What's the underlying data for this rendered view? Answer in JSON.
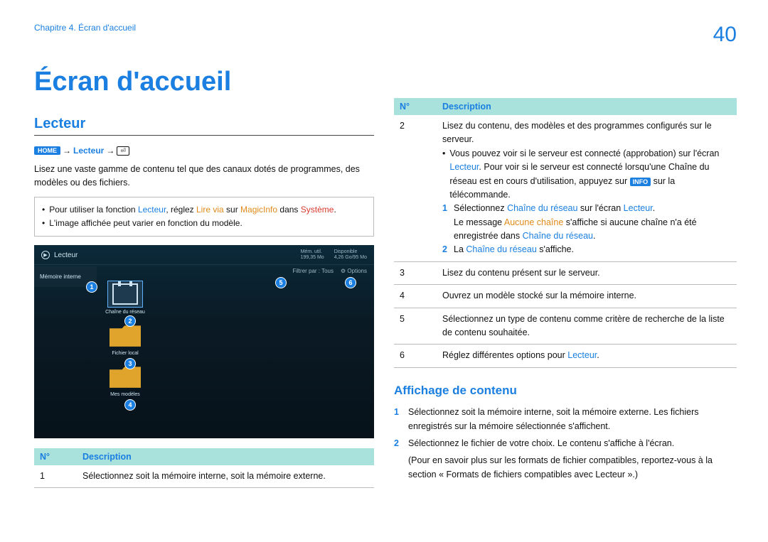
{
  "header": {
    "chapter": "Chapitre 4. Écran d'accueil",
    "page_number": "40"
  },
  "title": "Écran d'accueil",
  "section_heading": "Lecteur",
  "breadcrumb": {
    "home_label": "HOME",
    "arrow": "→",
    "crumb": "Lecteur",
    "enter_glyph": "⏎"
  },
  "intro_text": "Lisez une vaste gamme de contenu tel que des canaux dotés de programmes, des modèles ou des fichiers.",
  "note": {
    "line1_prefix": "Pour utiliser la fonction ",
    "line1_lecteur": "Lecteur",
    "line1_mid1": ", réglez ",
    "line1_lirevia": "Lire via",
    "line1_mid2": " sur ",
    "line1_magicinfo": "MagicInfo",
    "line1_mid3": " dans ",
    "line1_systeme": "Système",
    "line1_end": ".",
    "line2": "L'image affichée peut varier en fonction du modèle."
  },
  "screenshot": {
    "title": "Lecteur",
    "mem_used_label": "Mém. util.",
    "mem_used_value": "199,35 Mo",
    "disp_label": "Disponible",
    "disp_value": "4,26 Go/95 Mo",
    "filter_label": "Filtrer par : Tous",
    "options_label": "Options",
    "sidebar_item": "Mémoire interne",
    "tile1_label": "Chaîne du réseau",
    "tile2_label": "Fichier local",
    "tile3_label": "Mes modèles",
    "callouts": [
      "1",
      "2",
      "3",
      "4",
      "5",
      "6"
    ]
  },
  "table_head": {
    "num": "N°",
    "desc": "Description"
  },
  "table1_rows": [
    {
      "num": "1",
      "desc": "Sélectionnez soit la mémoire interne, soit la mémoire externe."
    }
  ],
  "table2_rows": {
    "r2": {
      "num": "2",
      "line1": "Lisez du contenu, des modèles et des programmes configurés sur le serveur.",
      "bullet_pre": "Vous pouvez voir si le serveur est connecté (approbation) sur l'écran ",
      "bullet_lecteur": "Lecteur",
      "bullet_mid": ". Pour voir si le serveur est connecté lorsqu'une Chaîne du réseau est en cours d'utilisation, appuyez sur ",
      "bullet_info": "INFO",
      "bullet_end": " sur la télécommande.",
      "s1_pre": "Sélectionnez ",
      "s1_chaine": "Chaîne du réseau",
      "s1_mid": " sur l'écran ",
      "s1_lecteur": "Lecteur",
      "s1_end": ".",
      "s1b_pre": "Le message ",
      "s1b_aucune": "Aucune chaîne",
      "s1b_mid": " s'affiche si aucune chaîne n'a été enregistrée dans ",
      "s1b_chaine": "Chaîne du réseau",
      "s1b_end": ".",
      "s2_pre": "La ",
      "s2_chaine": "Chaîne du réseau",
      "s2_end": " s'affiche."
    },
    "r3": {
      "num": "3",
      "desc": "Lisez du contenu présent sur le serveur."
    },
    "r4": {
      "num": "4",
      "desc": "Ouvrez un modèle stocké sur la mémoire interne."
    },
    "r5": {
      "num": "5",
      "desc": "Sélectionnez un type de contenu comme critère de recherche de la liste de contenu souhaitée."
    },
    "r6": {
      "num": "6",
      "pre": "Réglez différentes options pour ",
      "lecteur": "Lecteur",
      "end": "."
    }
  },
  "subsection_heading": "Affichage de contenu",
  "affichage_items": {
    "i1": {
      "n": "1",
      "text": "Sélectionnez soit la mémoire interne, soit la mémoire externe. Les fichiers enregistrés sur la mémoire sélectionnée s'affichent."
    },
    "i2": {
      "n": "2",
      "text": "Sélectionnez le fichier de votre choix. Le contenu s'affiche à l'écran."
    },
    "i2_note": "(Pour en savoir plus sur les formats de fichier compatibles, reportez-vous à la section « Formats de fichiers compatibles avec Lecteur ».)"
  }
}
